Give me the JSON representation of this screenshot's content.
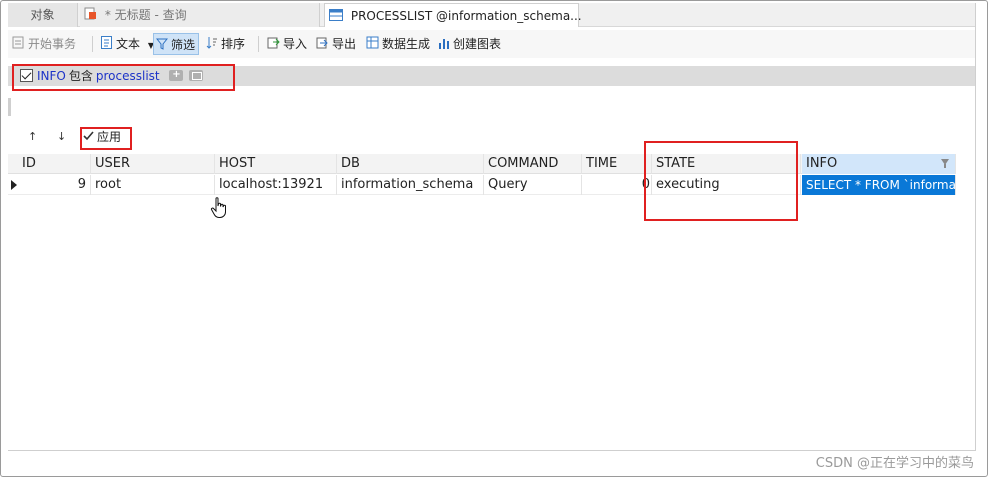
{
  "tabs": {
    "objects": "对象",
    "query": "* 无标题 - 查询",
    "processlist": "PROCESSLIST @information_schema..."
  },
  "toolbar": {
    "begin_transaction": "开始事务",
    "text": "文本",
    "filter": "筛选",
    "sort": "排序",
    "import": "导入",
    "export": "导出",
    "data_generation": "数据生成",
    "create_chart": "创建图表"
  },
  "filter": {
    "checked": true,
    "field": "INFO",
    "operator": "包含",
    "value": "processlist"
  },
  "apply": {
    "label": "应用"
  },
  "grid": {
    "columns": [
      "ID",
      "USER",
      "HOST",
      "DB",
      "COMMAND",
      "TIME",
      "STATE",
      "INFO"
    ],
    "rows": [
      {
        "id": "9",
        "user": "root",
        "host": "localhost:13921",
        "db": "information_schema",
        "command": "Query",
        "time": "0",
        "state": "executing",
        "info": "SELECT * FROM `informati"
      }
    ]
  },
  "watermark": "CSDN @正在学习中的菜鸟",
  "colors": {
    "annotation": "#e02020",
    "selection": "#0a78d7",
    "filter_text": "#1c33c8"
  }
}
